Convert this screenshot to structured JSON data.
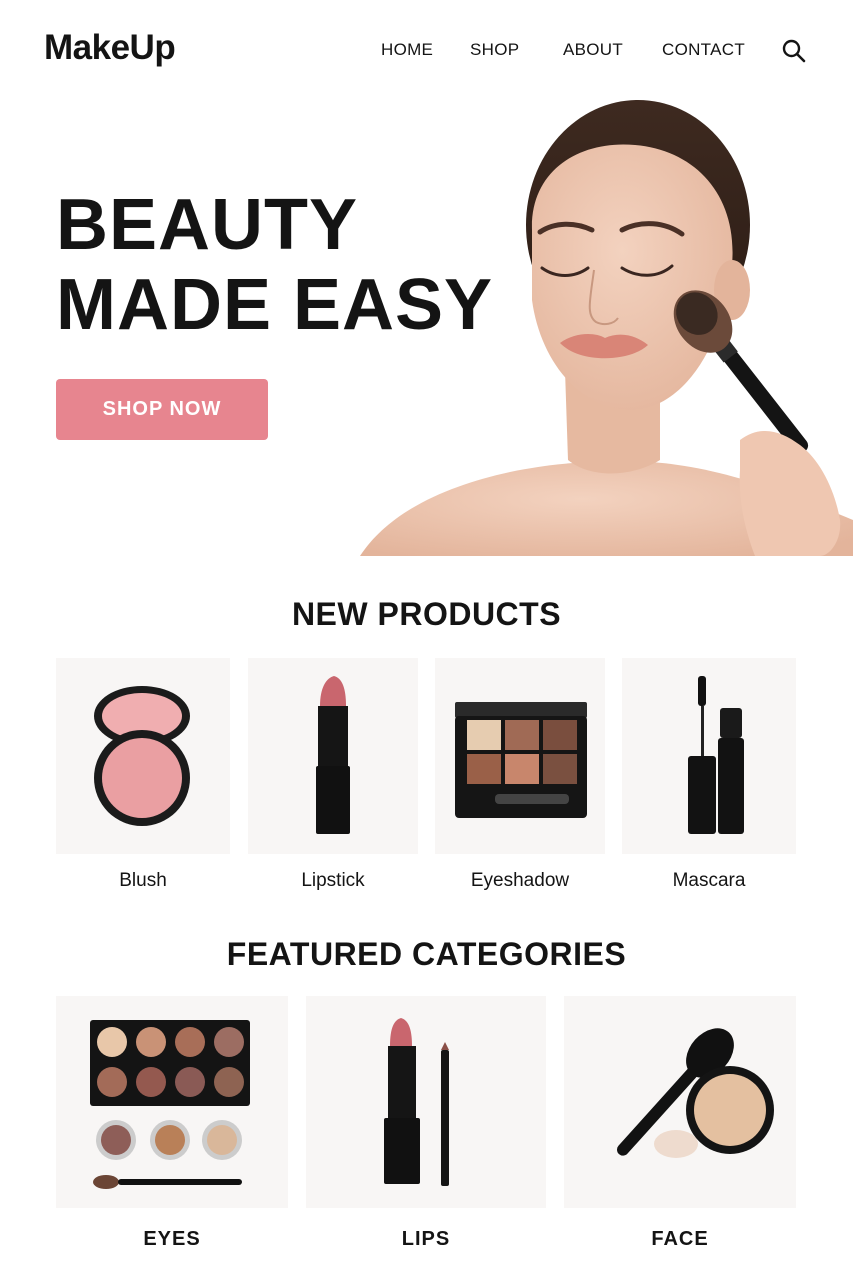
{
  "brand": {
    "name": "MakeUp"
  },
  "nav": {
    "items": [
      "HOME",
      "SHOP",
      "ABOUT",
      "CONTACT"
    ]
  },
  "hero": {
    "title_line1": "BEAUTY",
    "title_line2": "MADE EASY",
    "cta_label": "SHOP NOW"
  },
  "new_products": {
    "title": "NEW PRODUCTS",
    "items": [
      {
        "label": "Blush",
        "icon": "blush-compact-icon"
      },
      {
        "label": "Lipstick",
        "icon": "lipstick-icon"
      },
      {
        "label": "Eyeshadow",
        "icon": "eyeshadow-palette-icon"
      },
      {
        "label": "Mascara",
        "icon": "mascara-icon"
      }
    ]
  },
  "featured_categories": {
    "title": "FEATURED CATEGORIES",
    "items": [
      {
        "label": "EYES",
        "icon": "eye-palette-icon"
      },
      {
        "label": "LIPS",
        "icon": "lips-products-icon"
      },
      {
        "label": "FACE",
        "icon": "face-powder-icon"
      }
    ]
  },
  "colors": {
    "accent": "#e7858f",
    "hero_bg": "#f8f6f5",
    "text": "#141414"
  }
}
